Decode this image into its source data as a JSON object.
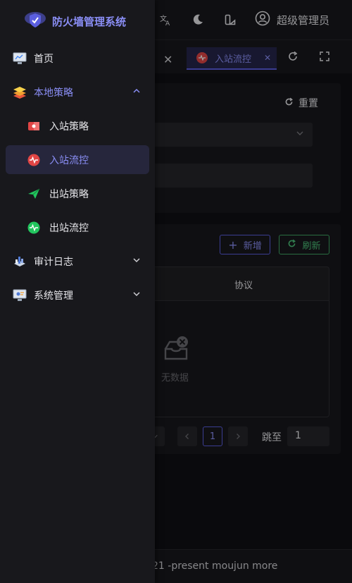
{
  "app": {
    "title": "防火墙管理系统",
    "accent": "#5b5fe0"
  },
  "header": {
    "user_name": "超级管理员",
    "icons": [
      "translate-icon",
      "theme-toggle-icon",
      "layout-icon",
      "user-icon"
    ]
  },
  "tabs": {
    "active_label": "入站流控"
  },
  "search": {
    "reset_label": "重置"
  },
  "toolbar": {
    "add_label": "新增",
    "refresh_label": "刷新"
  },
  "table": {
    "columns": [
      "协议"
    ],
    "empty_text": "无数据"
  },
  "pagination": {
    "current_page": "1",
    "jump_label": "跳至",
    "jump_value": "1"
  },
  "footer": {
    "text": "21 -present moujun more"
  },
  "sidebar": {
    "items": [
      {
        "label": "首页",
        "icon": "home-monitor-icon"
      },
      {
        "label": "本地策略",
        "icon": "layers-icon",
        "expanded": true,
        "children": [
          {
            "label": "入站策略",
            "icon": "inbound-policy-icon"
          },
          {
            "label": "入站流控",
            "icon": "inbound-flow-icon",
            "active": true
          },
          {
            "label": "出站策略",
            "icon": "send-icon"
          },
          {
            "label": "出站流控",
            "icon": "outbound-flow-icon"
          }
        ]
      },
      {
        "label": "审计日志",
        "icon": "audit-log-icon"
      },
      {
        "label": "系统管理",
        "icon": "system-admin-icon"
      }
    ]
  }
}
